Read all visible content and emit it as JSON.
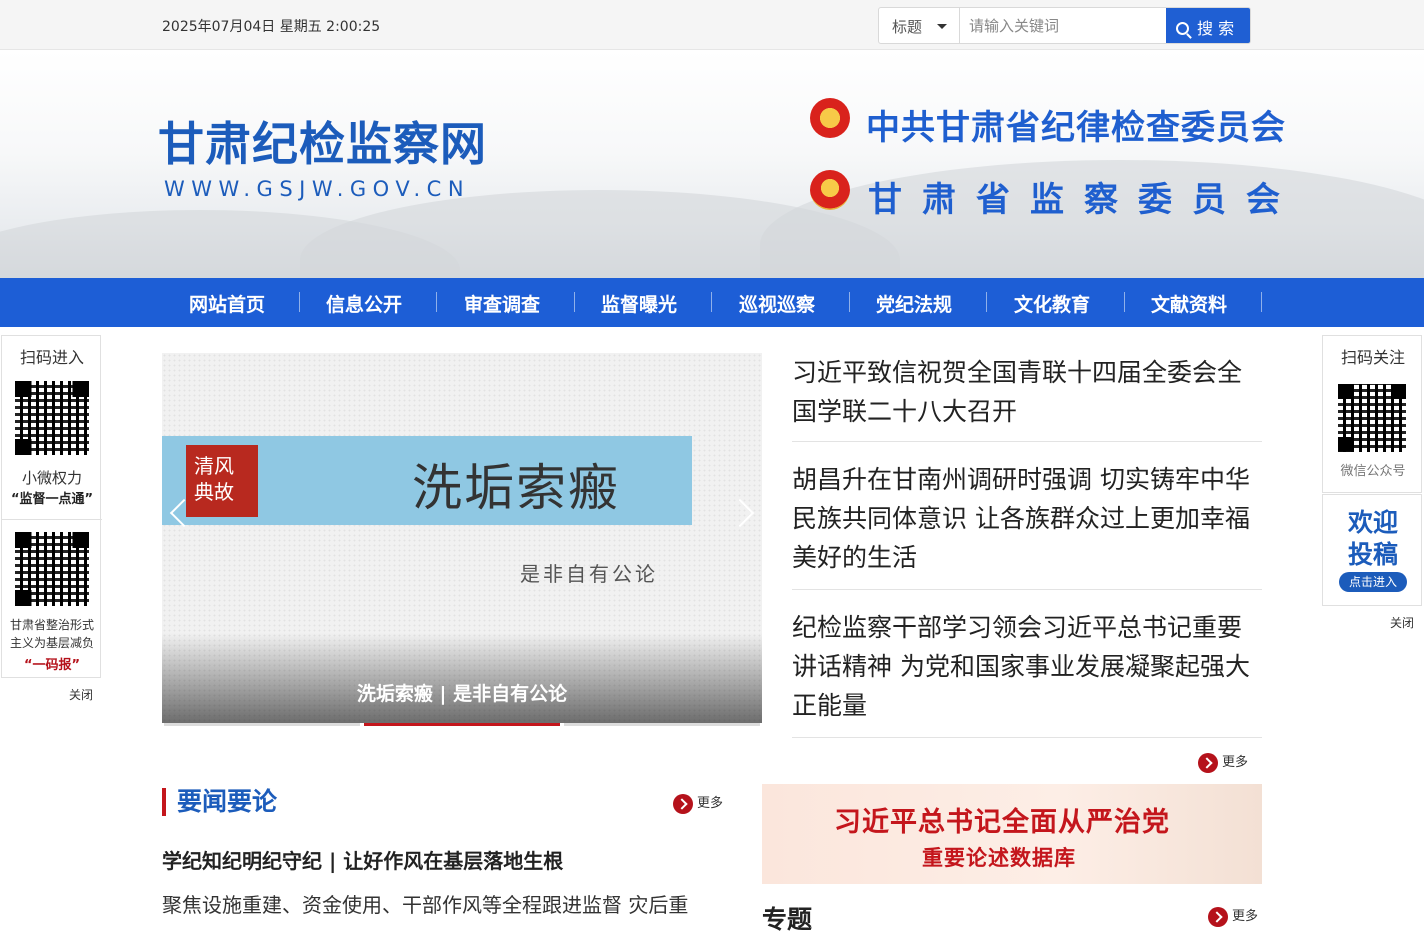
{
  "topbar": {
    "datetime": "2025年07月04日 星期五 2:00:25",
    "search_scope": "标题",
    "search_placeholder": "请输入关键词",
    "search_button": "搜 索"
  },
  "header": {
    "site_name": "甘肃纪检监察网",
    "site_url": "WWW.GSJW.GOV.CN",
    "org1": "中共甘肃省纪律检查委员会",
    "org2": "甘肃省监察委员会"
  },
  "nav": [
    "网站首页",
    "信息公开",
    "审查调查",
    "监督曝光",
    "巡视巡察",
    "党纪法规",
    "文化教育",
    "文献资料"
  ],
  "left_float": {
    "scan_title": "扫码进入",
    "qr1_line1": "小微权力",
    "qr1_line2": "“监督一点通”",
    "qr2_line1": "甘肃省整治形式",
    "qr2_line2": "主义为基层减负",
    "qr2_line3": "“一码报”",
    "close": "关闭"
  },
  "right_float": {
    "scan_title": "扫码关注",
    "wechat": "微信公众号",
    "welcome1": "欢迎",
    "welcome2": "投稿",
    "enter": "点击进入",
    "close": "关闭"
  },
  "slider": {
    "stamp": "清风典故",
    "title": "洗垢索瘢",
    "subtitle": "是非自有公论",
    "caption": "洗垢索瘢 | 是非自有公论",
    "active_index": 1,
    "count": 3
  },
  "headlines": {
    "items": [
      "习近平致信祝贺全国青联十四届全委会全国学联二十八大召开",
      "胡昌升在甘南州调研时强调 切实铸牢中华民族共同体意识 让各族群众过上更加幸福美好的生活",
      "纪检监察干部学习领会习近平总书记重要讲话精神 为党和国家事业发展凝聚起强大正能量"
    ],
    "more": "更多"
  },
  "news": {
    "section_title": "要闻要论",
    "more": "更多",
    "item1": "学纪知纪明纪守纪 | 让好作风在基层落地生根",
    "item2": "聚焦设施重建、资金使用、干部作风等全程跟进监督 灾后重"
  },
  "db_banner": {
    "line1": "习近平总书记全面从严治党",
    "line2": "重要论述数据库"
  },
  "special": {
    "title": "专题",
    "more": "更多"
  },
  "colors": {
    "brand_blue": "#1d5ed6",
    "accent_red": "#c4161c"
  }
}
